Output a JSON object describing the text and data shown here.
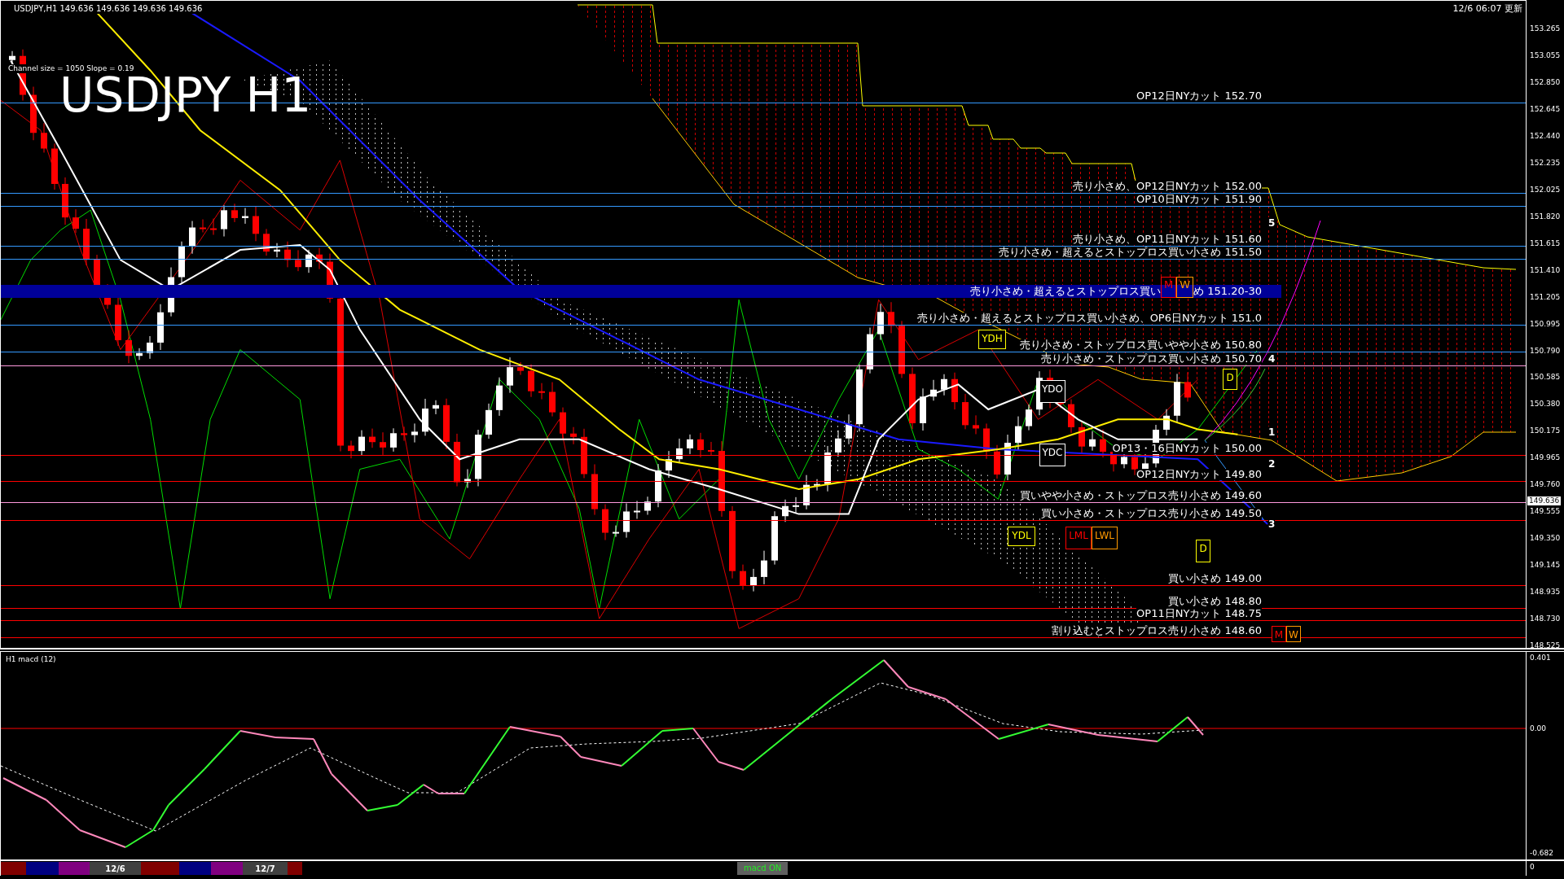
{
  "header": {
    "symbol_line": "USDJPY,H1  149.636 149.636 149.636 149.636",
    "channel_info": "Channel size = 1050 Slope = 0.19",
    "title": "USDJPY H1",
    "updated": "12/6 06:07 更新"
  },
  "levels": [
    {
      "kind": "line",
      "label": "OP12日NYカット 152.70",
      "color": "#3399ff"
    },
    {
      "kind": "line",
      "label": "売り小さめ、OP12日NYカット 152.00",
      "color": "#3399ff"
    },
    {
      "kind": "line",
      "label": "OP10日NYカット 151.90",
      "color": "#3399ff"
    },
    {
      "kind": "line",
      "label": "売り小さめ、OP11日NYカット 151.60",
      "color": "#3399ff"
    },
    {
      "kind": "line",
      "label": "売り小さめ・超えるとストップロス買い小さめ 151.50",
      "color": "#3399ff"
    },
    {
      "kind": "band",
      "label": "売り小さめ・超えるとストップロス買い",
      "label_after": "め 151.20-30",
      "color": "#000099",
      "markers": [
        {
          "label": "M",
          "color": "#ff0000"
        },
        {
          "label": "W",
          "color": "#ff9900"
        }
      ]
    },
    {
      "kind": "line",
      "label": "売り小さめ・超えるとストップロス買い小さめ、OP6日NYカット 151.0",
      "color": "#3399ff"
    },
    {
      "kind": "line",
      "label": "売り小さめ・ストップロス買いやや小さめ 150.80",
      "color": "#3399ff"
    },
    {
      "kind": "line",
      "label": "売り小さめ・ストップロス買い小さめ 150.70",
      "color": "#ff99dd"
    },
    {
      "kind": "line",
      "label": "OP13・16日NYカット 150.00",
      "color": "#ff0000"
    },
    {
      "kind": "line",
      "label": "OP12日NYカット 149.80",
      "color": "#ff0000"
    },
    {
      "kind": "line",
      "label": "買いやや小さめ・ストップロス売り小さめ 149.60",
      "color": "#ff99dd"
    },
    {
      "kind": "line",
      "label": "買い小さめ・ストップロス売り小さめ 149.50",
      "color": "#ff0000"
    },
    {
      "kind": "line",
      "label": "買い小さめ 149.00",
      "color": "#ff0000"
    },
    {
      "kind": "line",
      "label": "買い小さめ 148.80",
      "color": "#ff0000"
    },
    {
      "kind": "line",
      "label": "OP11日NYカット 148.75",
      "color": "#ff0000"
    },
    {
      "kind": "line",
      "label": "割り込むとストップロス売り小さめ 148.60",
      "color": "#ff0000"
    }
  ],
  "markers": [
    {
      "label": "YDO",
      "color": "#ffffff"
    },
    {
      "label": "YDC",
      "color": "#ffffff"
    },
    {
      "label": "YDH",
      "color": "#ffff00"
    },
    {
      "label": "D",
      "color": "#ffff00"
    },
    {
      "label": "YDL",
      "color": "#ffff00"
    },
    {
      "label": "LML",
      "color": "#ff0000"
    },
    {
      "label": "LWL",
      "color": "#ff9900"
    },
    {
      "label": "D",
      "color": "#ffff00"
    },
    {
      "label": "M",
      "color": "#ff0000"
    },
    {
      "label": "W",
      "color": "#ff9900"
    }
  ],
  "wave_numbers": [
    "5",
    "4",
    "1",
    "2",
    "3"
  ],
  "price_axis": [
    "153.265",
    "153.055",
    "152.850",
    "152.645",
    "152.440",
    "152.235",
    "152.025",
    "151.820",
    "151.615",
    "151.410",
    "151.205",
    "150.995",
    "150.790",
    "150.585",
    "150.380",
    "150.175",
    "149.965",
    "149.760",
    "149.555",
    "149.350",
    "149.145",
    "148.935",
    "148.730",
    "148.525"
  ],
  "current_price": "149.636",
  "macd": {
    "title": "H1  macd (12)",
    "axis": [
      "0.401",
      "0.00",
      "-0.682"
    ]
  },
  "bottom_bar": {
    "segments": [
      {
        "color": "#800000"
      },
      {
        "color": "#000080"
      },
      {
        "color": "#800080"
      },
      {
        "color": "#404040",
        "label": "12/6"
      },
      {
        "color": "#800000"
      },
      {
        "color": "#000080"
      },
      {
        "color": "#800080"
      },
      {
        "color": "#404040",
        "label": "12/7"
      },
      {
        "color": "#800000"
      }
    ],
    "button": "macd ON",
    "axis_label": "0"
  }
}
